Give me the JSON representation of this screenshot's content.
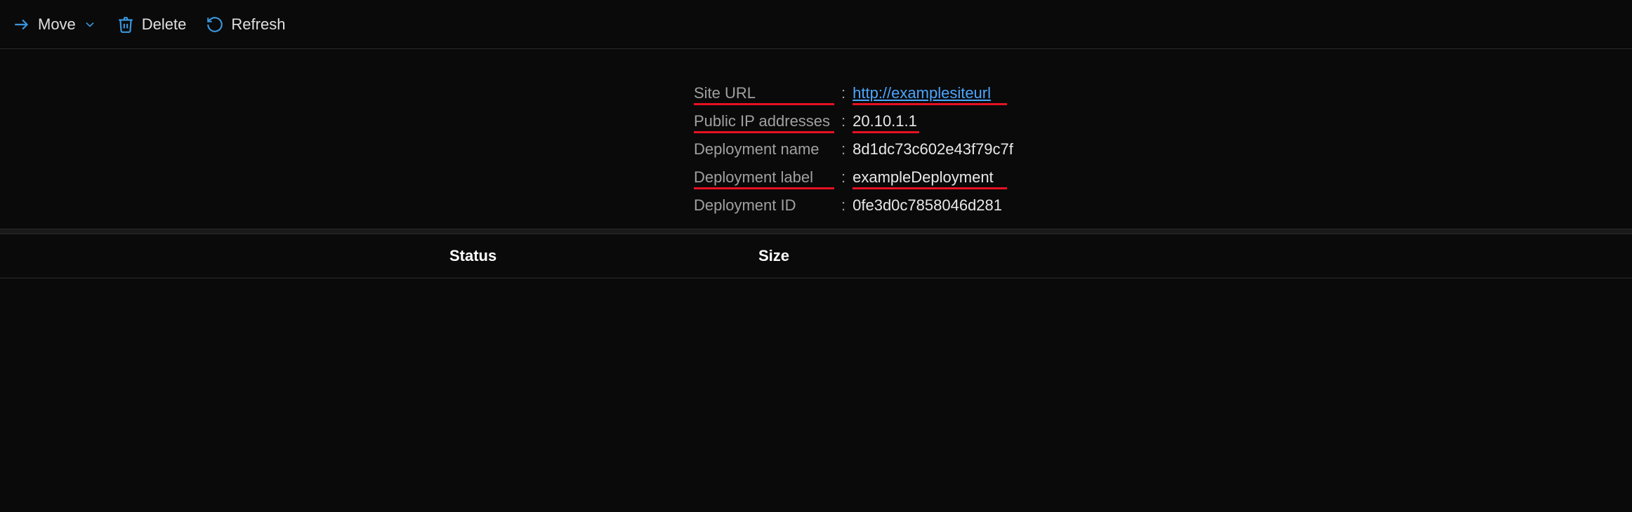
{
  "toolbar": {
    "move_label": "Move",
    "delete_label": "Delete",
    "refresh_label": "Refresh"
  },
  "details": {
    "site_url_label": "Site URL",
    "site_url_value": "http://examplesiteurl",
    "public_ip_label": "Public IP addresses",
    "public_ip_value": "20.10.1.1",
    "deployment_name_label": "Deployment name",
    "deployment_name_value": "8d1dc73c602e43f79c7f",
    "deployment_label_label": "Deployment label",
    "deployment_label_value": "exampleDeployment",
    "deployment_id_label": "Deployment ID",
    "deployment_id_value": "0fe3d0c7858046d281"
  },
  "table": {
    "status_header": "Status",
    "size_header": "Size"
  }
}
